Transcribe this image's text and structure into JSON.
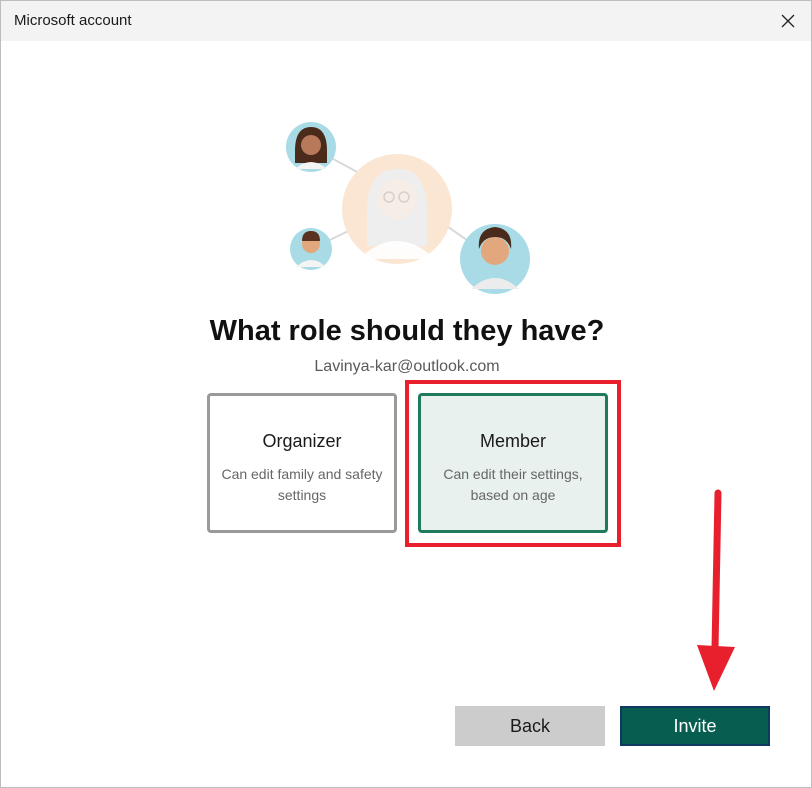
{
  "window": {
    "title": "Microsoft account"
  },
  "main": {
    "heading": "What role should they have?",
    "email": "Lavinya-kar@outlook.com"
  },
  "roles": [
    {
      "title": "Organizer",
      "description": "Can edit family and safety settings",
      "selected": false
    },
    {
      "title": "Member",
      "description": "Can edit their settings, based on age",
      "selected": true
    }
  ],
  "footer": {
    "back_label": "Back",
    "invite_label": "Invite"
  },
  "colors": {
    "accent": "#075e50",
    "selected_border": "#1f7a5e",
    "annotation_red": "#e8202e"
  },
  "icons": {
    "close": "close-icon",
    "illustration": "family-members-illustration"
  }
}
